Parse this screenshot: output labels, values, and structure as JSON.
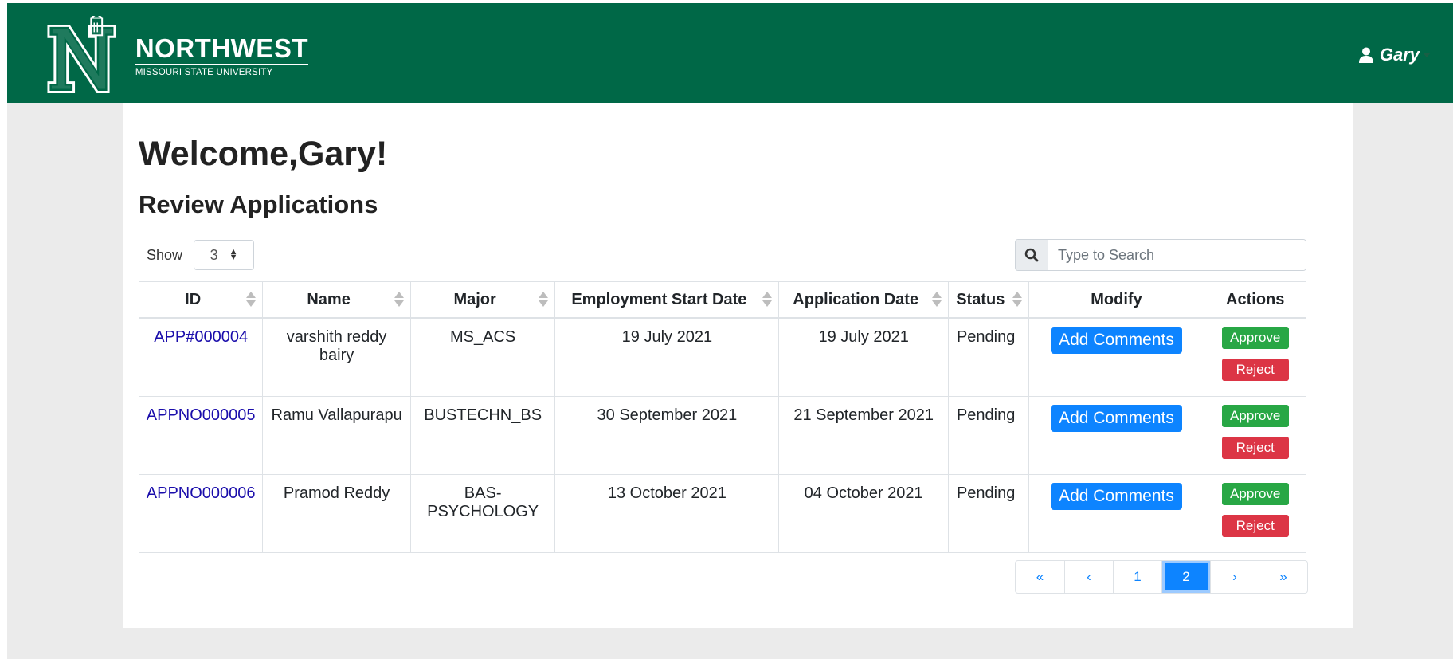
{
  "brand": {
    "name": "NORTHWEST",
    "subtitle": "MISSOURI STATE UNIVERSITY",
    "color": "#006847"
  },
  "user_menu": {
    "icon": "user-icon",
    "name": "Gary"
  },
  "page": {
    "welcome": "Welcome,Gary!",
    "subtitle": "Review Applications"
  },
  "show": {
    "label": "Show",
    "value": "3"
  },
  "search": {
    "icon": "search-icon",
    "placeholder": "Type to Search"
  },
  "table": {
    "columns": [
      "ID",
      "Name",
      "Major",
      "Employment Start Date",
      "Application Date",
      "Status",
      "Modify",
      "Actions"
    ],
    "rows": [
      {
        "id": "APP#000004",
        "name": "varshith reddy bairy",
        "major": "MS_ACS",
        "start": "19 July 2021",
        "applied": "19 July 2021",
        "status": "Pending"
      },
      {
        "id": "APPNO000005",
        "name": "Ramu Vallapurapu",
        "major": "BUSTECHN_BS",
        "start": "30 September 2021",
        "applied": "21 September 2021",
        "status": "Pending"
      },
      {
        "id": "APPNO000006",
        "name": "Pramod Reddy",
        "major": "BAS-PSYCHOLOGY",
        "start": "13 October 2021",
        "applied": "04 October 2021",
        "status": "Pending"
      }
    ],
    "modify_label": "Add Comments",
    "approve_label": "Approve",
    "reject_label": "Reject"
  },
  "pagination": {
    "first": "«",
    "prev": "‹",
    "pages": [
      "1",
      "2"
    ],
    "active_page": "2",
    "next": "›",
    "last": "»"
  },
  "colors": {
    "primary": "#0d84ff",
    "success": "#28a745",
    "danger": "#dc3545"
  }
}
